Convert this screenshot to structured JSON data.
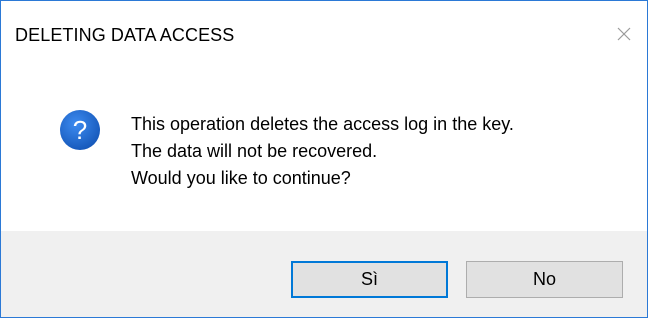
{
  "window": {
    "title": "DELETING DATA ACCESS",
    "close_icon": "close-icon"
  },
  "message": {
    "icon": "question-icon",
    "lines": [
      "This operation deletes the access log in the key.",
      "The data will not be recovered.",
      "Would you like to continue?"
    ]
  },
  "buttons": {
    "yes_label": "Sì",
    "no_label": "No"
  },
  "colors": {
    "accent": "#0078d7",
    "icon_blue": "#1a64c8",
    "footer_bg": "#f0f0f0"
  }
}
